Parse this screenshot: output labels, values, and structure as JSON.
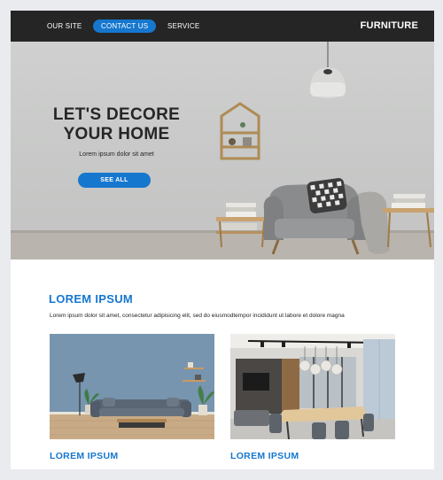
{
  "nav": {
    "items": [
      {
        "label": "OUR SITE"
      },
      {
        "label": "CONTACT US"
      },
      {
        "label": "SERVICE"
      }
    ],
    "brand": "FURNITURE"
  },
  "hero": {
    "title_line1": "LET'S DECORE",
    "title_line2": "YOUR HOME",
    "subtitle": "Lorem ipsum dolor sit amet",
    "button_label": "SEE ALL"
  },
  "section": {
    "title": "LOREM IPSUM",
    "text": "Lorem ipsum dolor sit amet, consectetur adipisicing elit, sed do eiusmodtempor incididunt ut labore et dolore magna"
  },
  "cards": [
    {
      "title": "LOREM IPSUM"
    },
    {
      "title": "LOREM IPSUM"
    }
  ],
  "colors": {
    "accent": "#1677cf",
    "nav_background": "#252525",
    "page_background": "#e9ebee"
  }
}
